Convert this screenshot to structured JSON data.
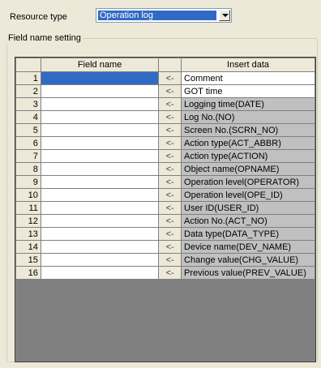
{
  "resource_type": {
    "label": "Resource type",
    "value": "Operation log"
  },
  "field_setting": {
    "legend": "Field name setting",
    "columns": {
      "field": "Field name",
      "insert": "Insert data"
    },
    "rows": [
      {
        "num": "1",
        "arrow": "<-",
        "insert": "Comment"
      },
      {
        "num": "2",
        "arrow": "<-",
        "insert": "GOT time"
      },
      {
        "num": "3",
        "arrow": "<-",
        "insert": "Logging time(DATE)"
      },
      {
        "num": "4",
        "arrow": "<-",
        "insert": "Log No.(NO)"
      },
      {
        "num": "5",
        "arrow": "<-",
        "insert": "Screen No.(SCRN_NO)"
      },
      {
        "num": "6",
        "arrow": "<-",
        "insert": "Action type(ACT_ABBR)"
      },
      {
        "num": "7",
        "arrow": "<-",
        "insert": "Action type(ACTION)"
      },
      {
        "num": "8",
        "arrow": "<-",
        "insert": "Object name(OPNAME)"
      },
      {
        "num": "9",
        "arrow": "<-",
        "insert": "Operation level(OPERATOR)"
      },
      {
        "num": "10",
        "arrow": "<-",
        "insert": "Operation level(OPE_ID)"
      },
      {
        "num": "11",
        "arrow": "<-",
        "insert": "User ID(USER_ID)"
      },
      {
        "num": "12",
        "arrow": "<-",
        "insert": "Action No.(ACT_NO)"
      },
      {
        "num": "13",
        "arrow": "<-",
        "insert": "Data type(DATA_TYPE)"
      },
      {
        "num": "14",
        "arrow": "<-",
        "insert": "Device name(DEV_NAME)"
      },
      {
        "num": "15",
        "arrow": "<-",
        "insert": "Change value(CHG_VALUE)"
      },
      {
        "num": "16",
        "arrow": "<-",
        "insert": "Previous value(PREV_VALUE)"
      }
    ]
  }
}
